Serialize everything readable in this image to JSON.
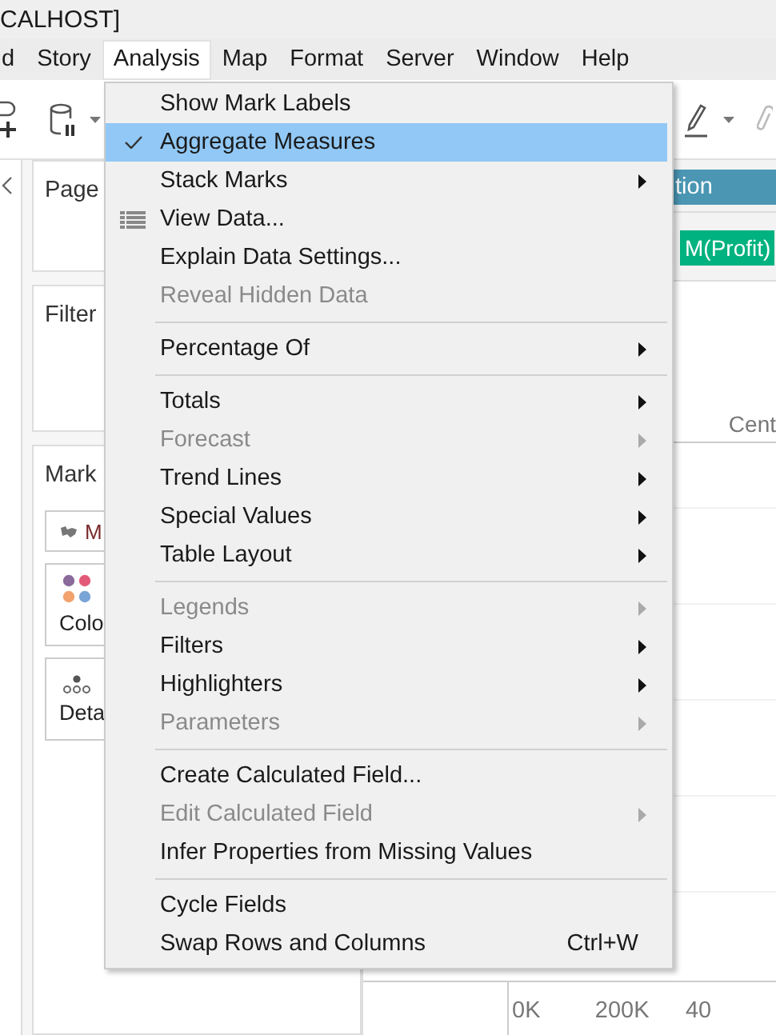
{
  "window": {
    "title": "CALHOST]"
  },
  "menubar": [
    {
      "label": "d",
      "selected": false
    },
    {
      "label": "Story",
      "selected": false
    },
    {
      "label": "Analysis",
      "selected": true
    },
    {
      "label": "Map",
      "selected": false
    },
    {
      "label": "Format",
      "selected": false
    },
    {
      "label": "Server",
      "selected": false
    },
    {
      "label": "Window",
      "selected": false
    },
    {
      "label": "Help",
      "selected": false
    }
  ],
  "side_cards": [
    {
      "title": "Page"
    },
    {
      "title": "Filter"
    },
    {
      "title": "Mark"
    }
  ],
  "marks": {
    "type_dropdown": "M",
    "buttons": [
      {
        "label": "Colo",
        "kind": "color"
      },
      {
        "label": "Deta",
        "kind": "detail"
      }
    ]
  },
  "columns_shelf": {
    "pill": "tion"
  },
  "rows_shelf": {
    "pill": "M(Profit)"
  },
  "view": {
    "header": "Cent",
    "axis_labels": [
      "0K",
      "200K",
      "40"
    ]
  },
  "menu": [
    {
      "kind": "item",
      "label": "Show Mark Labels",
      "checked": false,
      "disabled": false,
      "submenu": false
    },
    {
      "kind": "item",
      "label": "Aggregate Measures",
      "checked": true,
      "disabled": false,
      "submenu": false,
      "highlighted": true
    },
    {
      "kind": "item",
      "label": "Stack Marks",
      "checked": false,
      "disabled": false,
      "submenu": true
    },
    {
      "kind": "item",
      "label": "View Data...",
      "checked": false,
      "disabled": false,
      "submenu": false,
      "icon": true
    },
    {
      "kind": "item",
      "label": "Explain Data Settings...",
      "checked": false,
      "disabled": false,
      "submenu": false
    },
    {
      "kind": "item",
      "label": "Reveal Hidden Data",
      "checked": false,
      "disabled": true,
      "submenu": false
    },
    {
      "kind": "separator"
    },
    {
      "kind": "item",
      "label": "Percentage Of",
      "checked": false,
      "disabled": false,
      "submenu": true
    },
    {
      "kind": "separator"
    },
    {
      "kind": "item",
      "label": "Totals",
      "checked": false,
      "disabled": false,
      "submenu": true
    },
    {
      "kind": "item",
      "label": "Forecast",
      "checked": false,
      "disabled": true,
      "submenu": true
    },
    {
      "kind": "item",
      "label": "Trend Lines",
      "checked": false,
      "disabled": false,
      "submenu": true
    },
    {
      "kind": "item",
      "label": "Special Values",
      "checked": false,
      "disabled": false,
      "submenu": true
    },
    {
      "kind": "item",
      "label": "Table Layout",
      "checked": false,
      "disabled": false,
      "submenu": true
    },
    {
      "kind": "separator"
    },
    {
      "kind": "item",
      "label": "Legends",
      "checked": false,
      "disabled": true,
      "submenu": true
    },
    {
      "kind": "item",
      "label": "Filters",
      "checked": false,
      "disabled": false,
      "submenu": true
    },
    {
      "kind": "item",
      "label": "Highlighters",
      "checked": false,
      "disabled": false,
      "submenu": true
    },
    {
      "kind": "item",
      "label": "Parameters",
      "checked": false,
      "disabled": true,
      "submenu": true
    },
    {
      "kind": "separator"
    },
    {
      "kind": "item",
      "label": "Create Calculated Field...",
      "checked": false,
      "disabled": false,
      "submenu": false
    },
    {
      "kind": "item",
      "label": "Edit Calculated Field",
      "checked": false,
      "disabled": true,
      "submenu": true
    },
    {
      "kind": "item",
      "label": "Infer Properties from Missing Values",
      "checked": false,
      "disabled": false,
      "submenu": false
    },
    {
      "kind": "separator"
    },
    {
      "kind": "item",
      "label": "Cycle Fields",
      "checked": false,
      "disabled": false,
      "submenu": false
    },
    {
      "kind": "item",
      "label": "Swap Rows and Columns",
      "checked": false,
      "disabled": false,
      "submenu": false,
      "shortcut": "Ctrl+W"
    }
  ]
}
